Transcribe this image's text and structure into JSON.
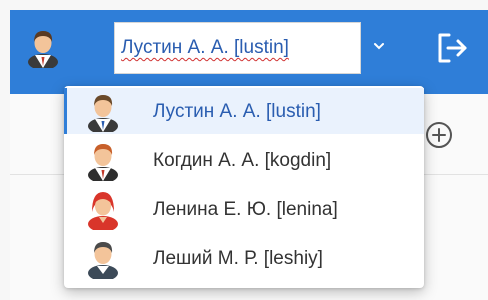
{
  "header": {
    "current_user": "Лустин А. А. [lustin]",
    "accent_color": "#2f7ed8",
    "user_icon": "male-user-icon",
    "chevron_icon": "chevron-down-icon",
    "logout_icon": "logout-icon"
  },
  "toolbar": {
    "add_icon": "plus-circle-icon"
  },
  "user_dropdown": {
    "options": [
      {
        "label": "Лустин А. А. [lustin]",
        "icon": "male-user-icon",
        "selected": true
      },
      {
        "label": "Когдин А. А. [kogdin]",
        "icon": "male-user-icon",
        "selected": false
      },
      {
        "label": "Ленина Е. Ю. [lenina]",
        "icon": "female-user-icon",
        "selected": false
      },
      {
        "label": "Леший М. Р. [leshiy]",
        "icon": "male-user-icon",
        "selected": false
      }
    ]
  }
}
